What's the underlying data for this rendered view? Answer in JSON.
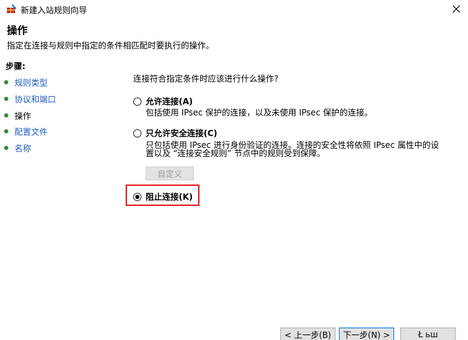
{
  "window": {
    "title": "新建入站规则向导",
    "close_glyph": "✕",
    "icon": "wizard-icon"
  },
  "header": {
    "title": "操作",
    "description": "指定在连接与规则中指定的条件相匹配时要执行的操作。"
  },
  "steps": {
    "heading": "步骤:",
    "items": [
      {
        "label": "规则类型"
      },
      {
        "label": "协议和端口"
      },
      {
        "label": "操作"
      },
      {
        "label": "配置文件"
      },
      {
        "label": "名称"
      }
    ]
  },
  "main": {
    "question": "连接符合指定条件时应该进行什么操作?",
    "options": [
      {
        "label": "允许连接(A)",
        "description": "包括使用 IPsec 保护的连接，以及未使用 IPsec 保护的连接。",
        "selected": false
      },
      {
        "label": "只允许安全连接(C)",
        "description_line1": "只包括使用 IPsec 进行身份验证的连接。连接的安全性将依照 IPsec 属性中的设",
        "description_line2": "置以及 “连接安全规则” 节点中的规则受到保障。",
        "selected": false
      },
      {
        "label": "阻止连接(K)",
        "selected": true
      }
    ],
    "customize_button": "自定义"
  },
  "footer": {
    "back_button": "< 上一步(B)",
    "next_button": "下一步(N) >",
    "partial_button": "Ł ьш"
  },
  "colors": {
    "highlight": "#e02020",
    "step_link": "#1f5bbf",
    "step_bullet": "#2e8b2e"
  }
}
